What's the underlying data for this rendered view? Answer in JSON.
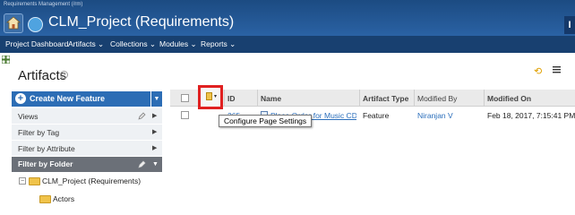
{
  "app": {
    "title": "Requirements Management (/rm)",
    "project_title": "CLM_Project (Requirements)",
    "right_mark": "I"
  },
  "nav": {
    "items": [
      {
        "label": "Project Dashboard"
      },
      {
        "label": "Artifacts ⌄"
      },
      {
        "label": "Collections ⌄"
      },
      {
        "label": "Modules ⌄"
      },
      {
        "label": "Reports ⌄"
      }
    ]
  },
  "page": {
    "title": "Artifacts",
    "help": "?"
  },
  "sidebar": {
    "create_button": "Create New Feature",
    "create_plus": "+",
    "create_dropdown": "▼",
    "sections": [
      {
        "label": "Views",
        "arrow": "▶"
      },
      {
        "label": "Filter by Tag",
        "arrow": "▶"
      },
      {
        "label": "Filter by Attribute",
        "arrow": "▶"
      },
      {
        "label": "Filter by Folder",
        "arrow": "▼"
      }
    ],
    "tree": [
      {
        "label": "CLM_Project (Requirements)",
        "toggle": "−"
      },
      {
        "label": "Actors"
      }
    ]
  },
  "table": {
    "columns": [
      "ID",
      "Name",
      "Artifact Type",
      "Modified By",
      "Modified On"
    ],
    "config_caret": "▾",
    "rows": [
      {
        "id": "265",
        "name": "Place Order for Music CD",
        "type": "Feature",
        "modified_by": "Niranjan V",
        "modified_on": "Feb 18, 2017, 7:15:41 PM"
      }
    ]
  },
  "tooltip": "Configure Page Settings",
  "colors": {
    "topbar": "#2a62a4",
    "navbar": "#184070",
    "accent": "#2c6db5",
    "highlight": "#e02020",
    "link": "#2a6ebb"
  }
}
